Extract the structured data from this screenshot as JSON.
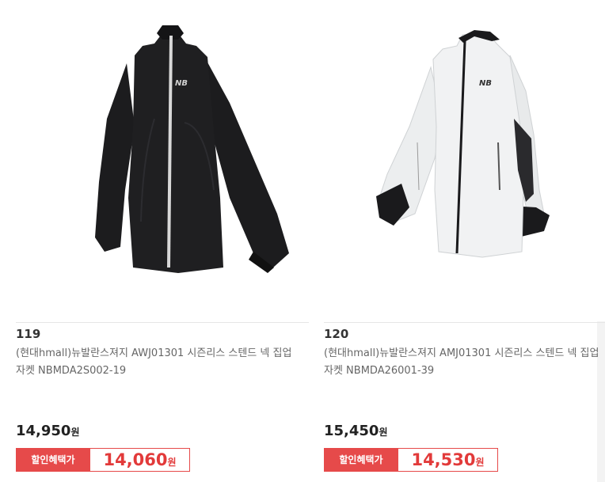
{
  "products": [
    {
      "rank": "119",
      "title": "(현대hmall)뉴발란스져지 AWJ01301 시즌리스 스텐드 넥 집업자켓 NBMDA2S002-19",
      "price": "14,950",
      "price_unit": "원",
      "badge": "할인혜택가",
      "sale_price": "14,060",
      "sale_unit": "원",
      "jacket_color": "#1c1c1e",
      "logo_text": "NB"
    },
    {
      "rank": "120",
      "title": "(현대hmall)뉴발란스져지 AMJ01301 시즌리스 스텐드 넥 집업자켓 NBMDA26001-39",
      "price": "15,450",
      "price_unit": "원",
      "badge": "할인혜택가",
      "sale_price": "14,530",
      "sale_unit": "원",
      "jacket_color": "#eef0f1",
      "logo_text": "NB"
    }
  ],
  "colors": {
    "accent_red": "#e64a4a",
    "text_dark": "#222222"
  }
}
